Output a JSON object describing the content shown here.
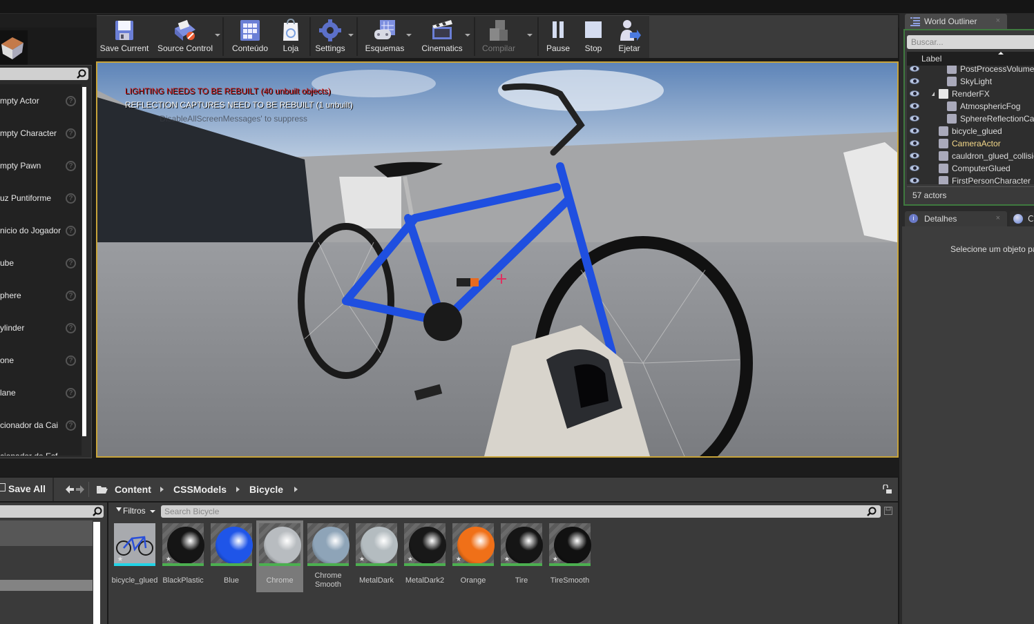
{
  "toolbar": {
    "buttons": [
      {
        "label": "Save Current",
        "icon": "save-icon"
      },
      {
        "label": "Source Control",
        "icon": "source-control-icon"
      },
      {
        "label": "Conteúdo",
        "icon": "content-icon"
      },
      {
        "label": "Loja",
        "icon": "marketplace-icon"
      },
      {
        "label": "Settings",
        "icon": "settings-icon"
      },
      {
        "label": "Esquemas",
        "icon": "blueprints-icon"
      },
      {
        "label": "Cinematics",
        "icon": "cinematics-icon"
      },
      {
        "label": "Compilar",
        "icon": "build-icon"
      },
      {
        "label": "Pause",
        "icon": "pause-icon"
      },
      {
        "label": "Stop",
        "icon": "stop-icon"
      },
      {
        "label": "Ejetar",
        "icon": "eject-icon"
      }
    ]
  },
  "place_panel": {
    "items": [
      "mpty Actor",
      "mpty Character",
      "mpty Pawn",
      "uz Puntiforme",
      "nicio do Jogador",
      "ube",
      "phere",
      "ylinder",
      "one",
      "lane",
      "cionador da Cai",
      "cionador de Esf"
    ]
  },
  "viewport": {
    "messages": {
      "lighting": "LIGHTING NEEDS TO BE REBUILT (40 unbuilt objects)",
      "reflection": "REFLECTION CAPTURES NEED TO BE REBUILT (1 unbuilt)",
      "suppress": "'DisableAllScreenMessages' to suppress"
    },
    "colors": {
      "lighting": "#d01818",
      "reflection": "#ffffff",
      "border": "#c8a43a"
    }
  },
  "world_outliner": {
    "tab_label": "World Outliner",
    "search_placeholder": "Buscar...",
    "column_label": "Label",
    "rows": [
      {
        "name": "PostProcessVolume",
        "indent": 2,
        "highlight": false
      },
      {
        "name": "SkyLight",
        "indent": 2,
        "highlight": false
      },
      {
        "name": "RenderFX",
        "indent": 1,
        "highlight": false,
        "folder": true
      },
      {
        "name": "AtmosphericFog",
        "indent": 2,
        "highlight": false
      },
      {
        "name": "SphereReflectionCapture",
        "indent": 2,
        "highlight": false
      },
      {
        "name": "bicycle_glued",
        "indent": 1,
        "highlight": false
      },
      {
        "name": "CameraActor",
        "indent": 1,
        "highlight": true
      },
      {
        "name": "cauldron_glued_collision",
        "indent": 1,
        "highlight": false
      },
      {
        "name": "ComputerGlued",
        "indent": 1,
        "highlight": false
      },
      {
        "name": "FirstPersonCharacter",
        "indent": 1,
        "highlight": false
      }
    ],
    "actor_count": "57 actors"
  },
  "details": {
    "tab_label": "Detalhes",
    "tab2_label": "C",
    "empty_message": "Selecione um objeto para visualizar detalhes."
  },
  "content_browser": {
    "save_all": "Save All",
    "breadcrumb": [
      "Content",
      "CSSModels",
      "Bicycle"
    ],
    "filters_label": "Filtros",
    "search_placeholder": "Search Bicycle",
    "assets": [
      {
        "name": "bicycle_glued",
        "type": "mesh",
        "color": "#2a4fd8",
        "bar": "#22d3e6"
      },
      {
        "name": "BlackPlastic",
        "type": "material",
        "color": "#151515",
        "bar": "#4caf50"
      },
      {
        "name": "Blue",
        "type": "material",
        "color": "#1f55e8",
        "bar": "#4caf50"
      },
      {
        "name": "Chrome",
        "type": "material",
        "color": "#b8bcc0",
        "bar": "#4caf50",
        "selected": true
      },
      {
        "name": "Chrome Smooth",
        "type": "material",
        "color": "#8ea4b8",
        "bar": "#4caf50"
      },
      {
        "name": "MetalDark",
        "type": "material",
        "color": "#b4bcc0",
        "bar": "#4caf50"
      },
      {
        "name": "MetalDark2",
        "type": "material",
        "color": "#181818",
        "bar": "#4caf50"
      },
      {
        "name": "Orange",
        "type": "material",
        "color": "#f07018",
        "bar": "#4caf50"
      },
      {
        "name": "Tire",
        "type": "material",
        "color": "#151515",
        "bar": "#4caf50"
      },
      {
        "name": "TireSmooth",
        "type": "material",
        "color": "#111111",
        "bar": "#4caf50"
      }
    ]
  }
}
